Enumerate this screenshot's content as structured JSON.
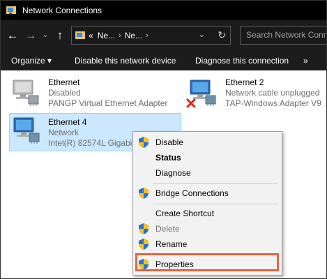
{
  "window": {
    "title": "Network Connections"
  },
  "address": {
    "prefix": "«",
    "crumbs": [
      "Ne...",
      "Ne..."
    ],
    "search_placeholder": "Search Network Conn"
  },
  "commands": {
    "organize": "Organize ▾",
    "disable_device": "Disable this network device",
    "diagnose": "Diagnose this connection",
    "more": "»"
  },
  "connections": [
    {
      "name": "Ethernet",
      "status": "Disabled",
      "adapter": "PANGP Virtual Ethernet Adapter"
    },
    {
      "name": "Ethernet 2",
      "status": "Network cable unplugged",
      "adapter": "TAP-Windows Adapter V9"
    },
    {
      "name": "Ethernet 4",
      "status": "Network",
      "adapter": "Intel(R) 82574L Gigabit"
    }
  ],
  "context_menu": {
    "disable": "Disable",
    "status": "Status",
    "diagnose": "Diagnose",
    "bridge": "Bridge Connections",
    "shortcut": "Create Shortcut",
    "delete": "Delete",
    "rename": "Rename",
    "properties": "Properties"
  },
  "colors": {
    "highlight_border": "#e8643c",
    "selection": "#cce8ff",
    "dark_bar": "#1c1c1c"
  }
}
